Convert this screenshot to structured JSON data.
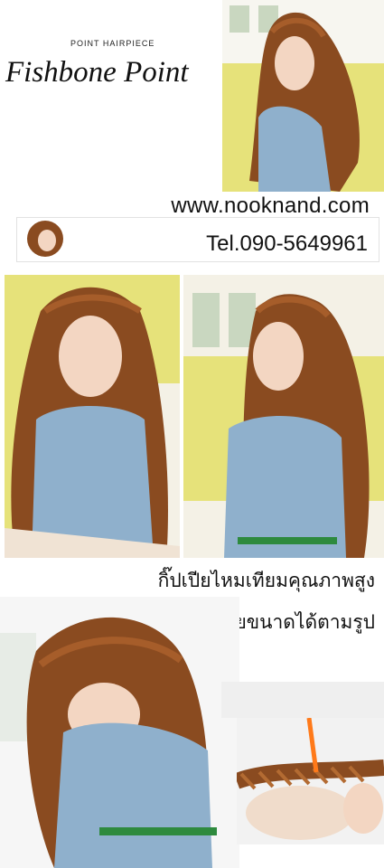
{
  "banner": {
    "subtitle": "POINT HAIRPIECE",
    "title": "Fishbone Point"
  },
  "contact": {
    "website": "www.nooknand.com",
    "phone": "Tel.090-5649961"
  },
  "captions": {
    "line1": "กิ๊ปเปียไหมเทียมคุณภาพสูง",
    "line2": "สามารถขยายขนาดได้ตามรูป"
  },
  "colors": {
    "wall_yellow": "#e6e27a",
    "hair_brown": "#8a4b20",
    "dress_blue": "#8fb0cc",
    "skin": "#f3d6c2"
  }
}
